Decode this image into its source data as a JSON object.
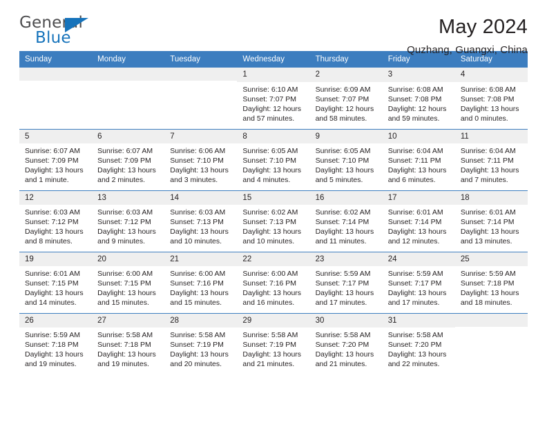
{
  "logo": {
    "word_top": "General",
    "word_bottom": "Blue",
    "triangle_color": "#1673bb",
    "top_color": "#4d4d4f"
  },
  "header": {
    "title": "May 2024",
    "subtitle": "Quzhang, Guangxi, China"
  },
  "theme": {
    "header_blue": "#3c7dbf",
    "daynum_gray": "#efefef",
    "text": "#231f20"
  },
  "weekday_headers": [
    "Sunday",
    "Monday",
    "Tuesday",
    "Wednesday",
    "Thursday",
    "Friday",
    "Saturday"
  ],
  "weeks": [
    [
      {
        "day": "",
        "sunrise": "",
        "sunset": "",
        "daylight1": "",
        "daylight2": ""
      },
      {
        "day": "",
        "sunrise": "",
        "sunset": "",
        "daylight1": "",
        "daylight2": ""
      },
      {
        "day": "",
        "sunrise": "",
        "sunset": "",
        "daylight1": "",
        "daylight2": ""
      },
      {
        "day": "1",
        "sunrise": "Sunrise: 6:10 AM",
        "sunset": "Sunset: 7:07 PM",
        "daylight1": "Daylight: 12 hours",
        "daylight2": "and 57 minutes."
      },
      {
        "day": "2",
        "sunrise": "Sunrise: 6:09 AM",
        "sunset": "Sunset: 7:07 PM",
        "daylight1": "Daylight: 12 hours",
        "daylight2": "and 58 minutes."
      },
      {
        "day": "3",
        "sunrise": "Sunrise: 6:08 AM",
        "sunset": "Sunset: 7:08 PM",
        "daylight1": "Daylight: 12 hours",
        "daylight2": "and 59 minutes."
      },
      {
        "day": "4",
        "sunrise": "Sunrise: 6:08 AM",
        "sunset": "Sunset: 7:08 PM",
        "daylight1": "Daylight: 13 hours",
        "daylight2": "and 0 minutes."
      }
    ],
    [
      {
        "day": "5",
        "sunrise": "Sunrise: 6:07 AM",
        "sunset": "Sunset: 7:09 PM",
        "daylight1": "Daylight: 13 hours",
        "daylight2": "and 1 minute."
      },
      {
        "day": "6",
        "sunrise": "Sunrise: 6:07 AM",
        "sunset": "Sunset: 7:09 PM",
        "daylight1": "Daylight: 13 hours",
        "daylight2": "and 2 minutes."
      },
      {
        "day": "7",
        "sunrise": "Sunrise: 6:06 AM",
        "sunset": "Sunset: 7:10 PM",
        "daylight1": "Daylight: 13 hours",
        "daylight2": "and 3 minutes."
      },
      {
        "day": "8",
        "sunrise": "Sunrise: 6:05 AM",
        "sunset": "Sunset: 7:10 PM",
        "daylight1": "Daylight: 13 hours",
        "daylight2": "and 4 minutes."
      },
      {
        "day": "9",
        "sunrise": "Sunrise: 6:05 AM",
        "sunset": "Sunset: 7:10 PM",
        "daylight1": "Daylight: 13 hours",
        "daylight2": "and 5 minutes."
      },
      {
        "day": "10",
        "sunrise": "Sunrise: 6:04 AM",
        "sunset": "Sunset: 7:11 PM",
        "daylight1": "Daylight: 13 hours",
        "daylight2": "and 6 minutes."
      },
      {
        "day": "11",
        "sunrise": "Sunrise: 6:04 AM",
        "sunset": "Sunset: 7:11 PM",
        "daylight1": "Daylight: 13 hours",
        "daylight2": "and 7 minutes."
      }
    ],
    [
      {
        "day": "12",
        "sunrise": "Sunrise: 6:03 AM",
        "sunset": "Sunset: 7:12 PM",
        "daylight1": "Daylight: 13 hours",
        "daylight2": "and 8 minutes."
      },
      {
        "day": "13",
        "sunrise": "Sunrise: 6:03 AM",
        "sunset": "Sunset: 7:12 PM",
        "daylight1": "Daylight: 13 hours",
        "daylight2": "and 9 minutes."
      },
      {
        "day": "14",
        "sunrise": "Sunrise: 6:03 AM",
        "sunset": "Sunset: 7:13 PM",
        "daylight1": "Daylight: 13 hours",
        "daylight2": "and 10 minutes."
      },
      {
        "day": "15",
        "sunrise": "Sunrise: 6:02 AM",
        "sunset": "Sunset: 7:13 PM",
        "daylight1": "Daylight: 13 hours",
        "daylight2": "and 10 minutes."
      },
      {
        "day": "16",
        "sunrise": "Sunrise: 6:02 AM",
        "sunset": "Sunset: 7:14 PM",
        "daylight1": "Daylight: 13 hours",
        "daylight2": "and 11 minutes."
      },
      {
        "day": "17",
        "sunrise": "Sunrise: 6:01 AM",
        "sunset": "Sunset: 7:14 PM",
        "daylight1": "Daylight: 13 hours",
        "daylight2": "and 12 minutes."
      },
      {
        "day": "18",
        "sunrise": "Sunrise: 6:01 AM",
        "sunset": "Sunset: 7:14 PM",
        "daylight1": "Daylight: 13 hours",
        "daylight2": "and 13 minutes."
      }
    ],
    [
      {
        "day": "19",
        "sunrise": "Sunrise: 6:01 AM",
        "sunset": "Sunset: 7:15 PM",
        "daylight1": "Daylight: 13 hours",
        "daylight2": "and 14 minutes."
      },
      {
        "day": "20",
        "sunrise": "Sunrise: 6:00 AM",
        "sunset": "Sunset: 7:15 PM",
        "daylight1": "Daylight: 13 hours",
        "daylight2": "and 15 minutes."
      },
      {
        "day": "21",
        "sunrise": "Sunrise: 6:00 AM",
        "sunset": "Sunset: 7:16 PM",
        "daylight1": "Daylight: 13 hours",
        "daylight2": "and 15 minutes."
      },
      {
        "day": "22",
        "sunrise": "Sunrise: 6:00 AM",
        "sunset": "Sunset: 7:16 PM",
        "daylight1": "Daylight: 13 hours",
        "daylight2": "and 16 minutes."
      },
      {
        "day": "23",
        "sunrise": "Sunrise: 5:59 AM",
        "sunset": "Sunset: 7:17 PM",
        "daylight1": "Daylight: 13 hours",
        "daylight2": "and 17 minutes."
      },
      {
        "day": "24",
        "sunrise": "Sunrise: 5:59 AM",
        "sunset": "Sunset: 7:17 PM",
        "daylight1": "Daylight: 13 hours",
        "daylight2": "and 17 minutes."
      },
      {
        "day": "25",
        "sunrise": "Sunrise: 5:59 AM",
        "sunset": "Sunset: 7:18 PM",
        "daylight1": "Daylight: 13 hours",
        "daylight2": "and 18 minutes."
      }
    ],
    [
      {
        "day": "26",
        "sunrise": "Sunrise: 5:59 AM",
        "sunset": "Sunset: 7:18 PM",
        "daylight1": "Daylight: 13 hours",
        "daylight2": "and 19 minutes."
      },
      {
        "day": "27",
        "sunrise": "Sunrise: 5:58 AM",
        "sunset": "Sunset: 7:18 PM",
        "daylight1": "Daylight: 13 hours",
        "daylight2": "and 19 minutes."
      },
      {
        "day": "28",
        "sunrise": "Sunrise: 5:58 AM",
        "sunset": "Sunset: 7:19 PM",
        "daylight1": "Daylight: 13 hours",
        "daylight2": "and 20 minutes."
      },
      {
        "day": "29",
        "sunrise": "Sunrise: 5:58 AM",
        "sunset": "Sunset: 7:19 PM",
        "daylight1": "Daylight: 13 hours",
        "daylight2": "and 21 minutes."
      },
      {
        "day": "30",
        "sunrise": "Sunrise: 5:58 AM",
        "sunset": "Sunset: 7:20 PM",
        "daylight1": "Daylight: 13 hours",
        "daylight2": "and 21 minutes."
      },
      {
        "day": "31",
        "sunrise": "Sunrise: 5:58 AM",
        "sunset": "Sunset: 7:20 PM",
        "daylight1": "Daylight: 13 hours",
        "daylight2": "and 22 minutes."
      },
      {
        "day": "",
        "sunrise": "",
        "sunset": "",
        "daylight1": "",
        "daylight2": ""
      }
    ]
  ]
}
